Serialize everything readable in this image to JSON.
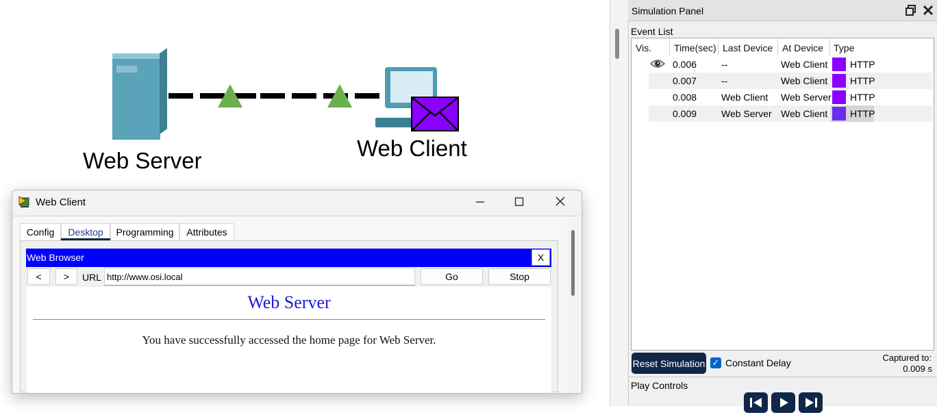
{
  "workspace": {
    "devices": {
      "server_label": "Web Server",
      "client_label": "Web Client"
    },
    "pdu_color": "#8c00ff",
    "link_indicator_color": "#6ab04c"
  },
  "simulation_panel": {
    "title": "Simulation Panel",
    "event_list_label": "Event List",
    "columns": [
      "Vis.",
      "Time(sec)",
      "Last Device",
      "At Device",
      "Type"
    ],
    "events": [
      {
        "visible_icon": "eye-icon",
        "time": "0.006",
        "last_device": "--",
        "at_device": "Web Client",
        "type": "HTTP",
        "color": "#8c00ff"
      },
      {
        "visible_icon": "",
        "time": "0.007",
        "last_device": "--",
        "at_device": "Web Client",
        "type": "HTTP",
        "color": "#8c00ff"
      },
      {
        "visible_icon": "",
        "time": "0.008",
        "last_device": "Web Client",
        "at_device": "Web Server",
        "type": "HTTP",
        "color": "#8c00ff"
      },
      {
        "visible_icon": "",
        "time": "0.009",
        "last_device": "Web Server",
        "at_device": "Web Client",
        "type": "HTTP",
        "color": "#6a2ef0"
      }
    ],
    "reset_label": "Reset Simulation",
    "constant_delay_label": "Constant Delay",
    "constant_delay_checked": true,
    "captured_label": "Captured to:",
    "captured_value": "0.009 s",
    "play_controls_label": "Play Controls"
  },
  "web_client_window": {
    "title": "Web Client",
    "tabs": [
      {
        "label": "Config"
      },
      {
        "label": "Desktop"
      },
      {
        "label": "Programming"
      },
      {
        "label": "Attributes"
      }
    ],
    "active_tab": "Desktop",
    "browser": {
      "title": "Web Browser",
      "close_label": "X",
      "back_label": "<",
      "forward_label": ">",
      "url_label": "URL",
      "url_value": "http://www.osi.local",
      "go_label": "Go",
      "stop_label": "Stop",
      "page_heading": "Web Server",
      "page_text": "You have successfully accessed the home page for Web Server."
    }
  }
}
